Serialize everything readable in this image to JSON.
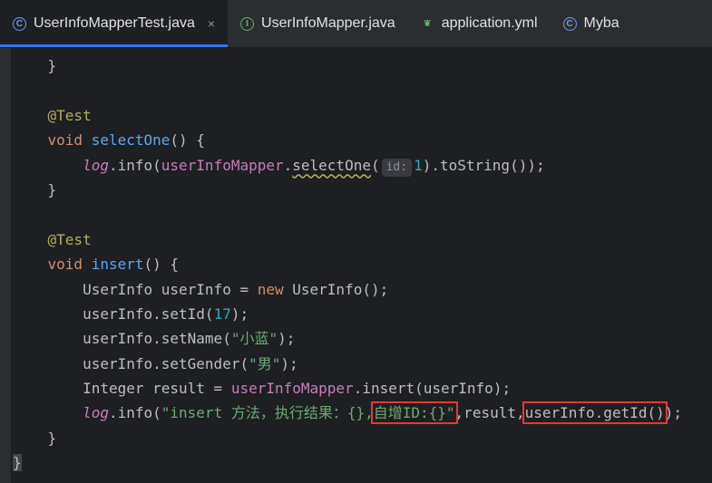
{
  "tabs": [
    {
      "label": "UserInfoMapperTest.java",
      "icon": "class-icon",
      "active": true,
      "close": "×"
    },
    {
      "label": "UserInfoMapper.java",
      "icon": "interface-icon",
      "active": false
    },
    {
      "label": "application.yml",
      "icon": "spring-yml-icon",
      "active": false
    },
    {
      "label": "Myba",
      "icon": "class-icon",
      "active": false
    }
  ],
  "icon_glyphs": {
    "class": "C",
    "interface": "I",
    "yml": "❦"
  },
  "code": {
    "l0_brace": "}",
    "l1_ann": "@Test",
    "l2_void": "void ",
    "l2_fn": "selectOne",
    "l2_rest": "() {",
    "l3_log": "log",
    "l3_info": ".info(",
    "l3_mapper": "userInfoMapper",
    "l3_dot": ".",
    "l3_sel": "selectOne",
    "l3_paren": "(",
    "l3_hint": "id:",
    "l3_num": "1",
    "l3_rest": ").toString());",
    "l4_brace": "}",
    "l5_ann": "@Test",
    "l6_void": "void ",
    "l6_fn": "insert",
    "l6_rest": "() {",
    "l7_a": "UserInfo userInfo = ",
    "l7_new": "new",
    "l7_b": " UserInfo();",
    "l8_a": "userInfo.setId(",
    "l8_num": "17",
    "l8_b": ");",
    "l9_a": "userInfo.setName(",
    "l9_str": "\"小蓝\"",
    "l9_b": ");",
    "l10_a": "userInfo.setGender(",
    "l10_str": "\"男\"",
    "l10_b": ");",
    "l11_a": "Integer result = ",
    "l11_mapper": "userInfoMapper",
    "l11_b": ".insert(userInfo);",
    "l12_log": "log",
    "l12_info": ".info(",
    "l12_str1": "\"insert 方法，执行结果：{},",
    "l12_str2": "自增ID:{}\"",
    "l12_b": ",result,",
    "l12_c": "userInfo.getId()",
    "l12_d": ");",
    "l13_brace": "}",
    "l14_brace": "}"
  },
  "colors": {
    "highlight_box": "#e53935",
    "active_tab_underline": "#3574f0"
  }
}
